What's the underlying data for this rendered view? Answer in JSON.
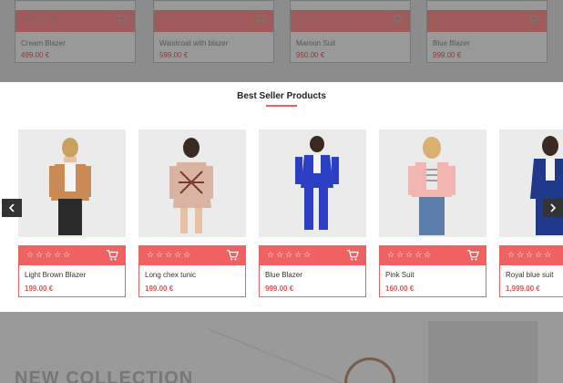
{
  "background_products": [
    {
      "name": "Cream Blazer",
      "price": "499.00 €"
    },
    {
      "name": "Waistcoat with blazer",
      "price": "599.00 €"
    },
    {
      "name": "Maroon Suit",
      "price": "950.00 €"
    },
    {
      "name": "Blue Blazer",
      "price": "999.00 €"
    }
  ],
  "best_sellers": {
    "title": "Best Seller Products",
    "products": [
      {
        "name": "Light Brown Blazer",
        "price": "199.00 €",
        "rating": 0
      },
      {
        "name": "Long chex tunic",
        "price": "199.00 €",
        "rating": 0
      },
      {
        "name": "Blue Blazer",
        "price": "999.00 €",
        "rating": 0
      },
      {
        "name": "Pink Suit",
        "price": "160.00 €",
        "rating": 0
      },
      {
        "name": "Royal blue suit",
        "price": "1,999.00 €",
        "rating": 0
      }
    ]
  },
  "banner": {
    "heading": "NEW COLLECTION"
  },
  "colors": {
    "accent": "#f06262",
    "price": "#e85050",
    "arrow_bg": "#333333"
  },
  "icons": {
    "prev": "chevron-left-icon",
    "next": "chevron-right-icon",
    "cart": "cart-icon",
    "star": "star-icon"
  }
}
